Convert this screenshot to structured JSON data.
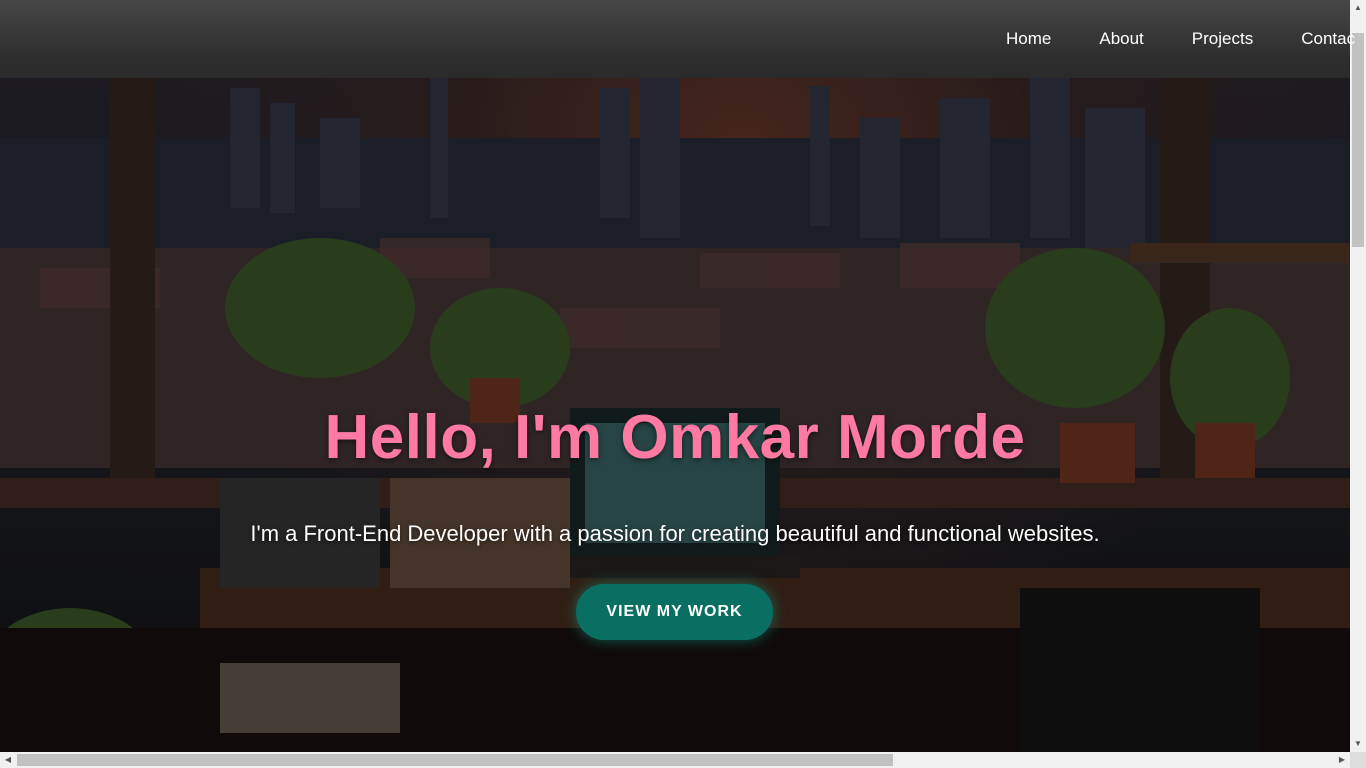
{
  "nav": {
    "items": [
      {
        "label": "Home"
      },
      {
        "label": "About"
      },
      {
        "label": "Projects"
      },
      {
        "label": "Contac"
      }
    ]
  },
  "hero": {
    "title": "Hello, I'm Omkar Morde",
    "subtitle": "I'm a Front-End Developer with a passion for creating beautiful and functional websites.",
    "cta_label": "VIEW MY WORK",
    "background_image": "lofi-city-desk-illustration"
  },
  "colors": {
    "title": "#ff7aa2",
    "cta_bg": "#0a6f63",
    "navbar_bg": "#333333"
  },
  "scrollbars": {
    "vertical_arrow_up": "up-arrow-icon",
    "vertical_arrow_down": "down-arrow-icon",
    "horizontal_arrow_left": "left-arrow-icon",
    "horizontal_arrow_right": "right-arrow-icon"
  }
}
